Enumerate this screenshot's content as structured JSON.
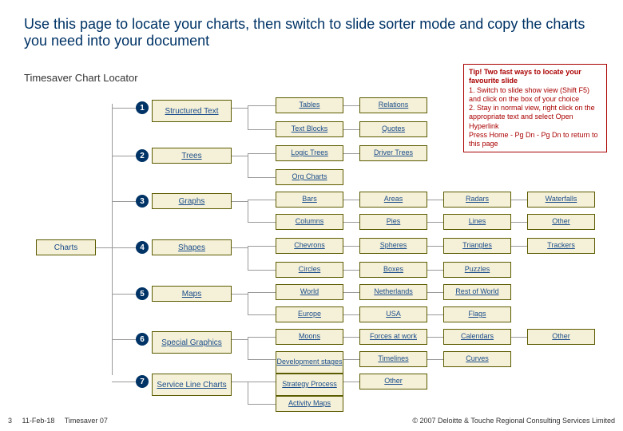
{
  "title": "Use this page to locate your charts, then switch to slide sorter mode and copy the charts you need into your document",
  "subtitle": "Timesaver Chart Locator",
  "tip": {
    "heading": "Tip! Two fast ways to locate your favourite slide",
    "line1": "1. Switch to slide show view (Shift F5) and click on the box of your choice",
    "line2": "2. Stay in normal view, right click on the appropriate text and select Open Hyperlink",
    "line3": "Press Home - Pg Dn - Pg Dn to return to this page"
  },
  "root": "Charts",
  "categories": [
    {
      "num": "1",
      "label": "Structured Text"
    },
    {
      "num": "2",
      "label": "Trees"
    },
    {
      "num": "3",
      "label": "Graphs"
    },
    {
      "num": "4",
      "label": "Shapes"
    },
    {
      "num": "5",
      "label": "Maps"
    },
    {
      "num": "6",
      "label": "Special Graphics"
    },
    {
      "num": "7",
      "label": "Service Line Charts"
    }
  ],
  "leaves": {
    "r1": [
      "Tables",
      "Relations"
    ],
    "r2": [
      "Text Blocks",
      "Quotes"
    ],
    "r3": [
      "Logic Trees",
      "Driver Trees"
    ],
    "r4": [
      "Org Charts"
    ],
    "r5": [
      "Bars",
      "Areas",
      "Radars",
      "Waterfalls"
    ],
    "r6": [
      "Columns",
      "Pies",
      "Lines",
      "Other"
    ],
    "r7": [
      "Chevrons",
      "Spheres",
      "Triangles",
      "Trackers"
    ],
    "r8": [
      "Circles",
      "Boxes",
      "Puzzles"
    ],
    "r9": [
      "World",
      "Netherlands",
      "Rest of World"
    ],
    "r10": [
      "Europe",
      "USA",
      "Flags"
    ],
    "r11": [
      "Moons",
      "Forces at work",
      "Calendars",
      "Other"
    ],
    "r12": [
      "Development stages",
      "Timelines",
      "Curves"
    ],
    "r13": [
      "Strategy Process",
      "Other"
    ],
    "r14": [
      "Activity Maps"
    ]
  },
  "footer": {
    "page": "3",
    "date": "11-Feb-18",
    "product": "Timesaver 07",
    "copyright": "© 2007 Deloitte & Touche Regional Consulting Services Limited"
  }
}
